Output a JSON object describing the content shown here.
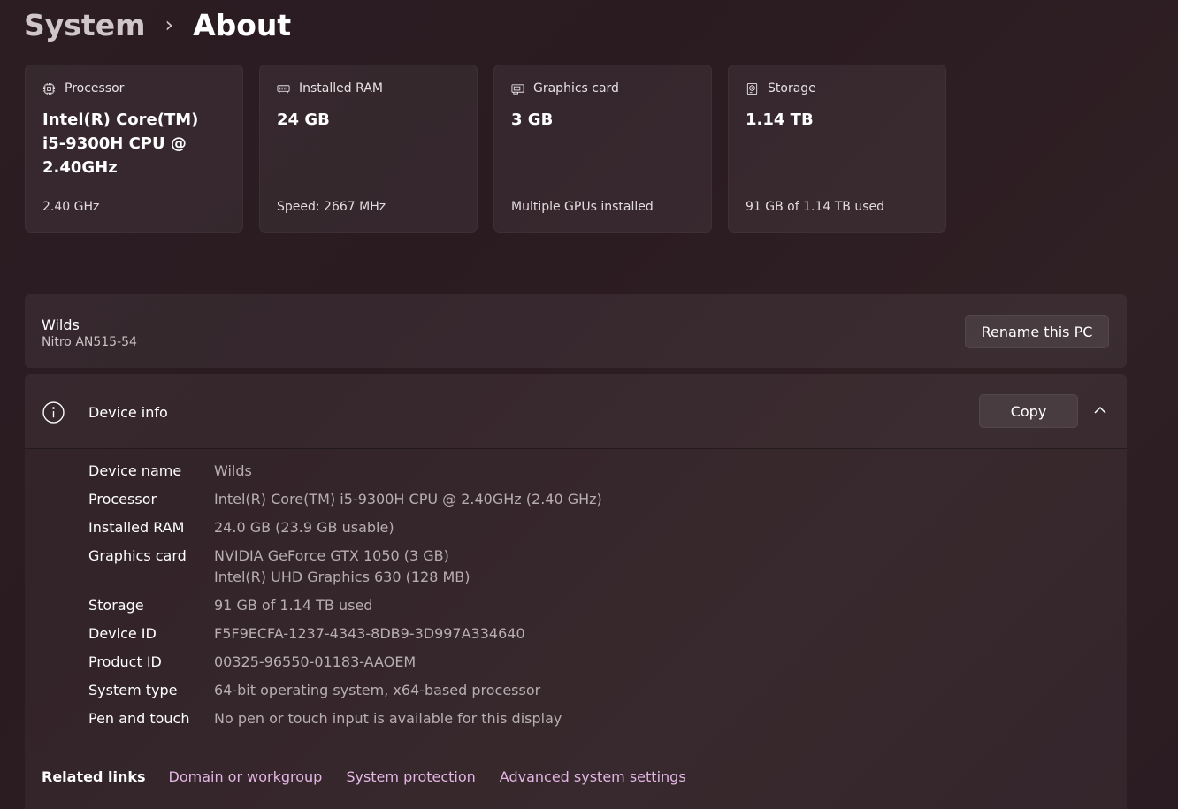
{
  "breadcrumb": {
    "parent": "System",
    "separator": "›",
    "current": "About"
  },
  "cards": [
    {
      "icon": "processor-icon",
      "title": "Processor",
      "value": "Intel(R) Core(TM) i5-9300H CPU @ 2.40GHz",
      "sub": "2.40 GHz"
    },
    {
      "icon": "ram-icon",
      "title": "Installed RAM",
      "value": "24 GB",
      "sub": "Speed: 2667 MHz"
    },
    {
      "icon": "graphics-card-icon",
      "title": "Graphics card",
      "value": "3 GB",
      "sub": "Multiple GPUs installed"
    },
    {
      "icon": "storage-icon",
      "title": "Storage",
      "value": "1.14 TB",
      "sub": "91 GB of 1.14 TB used"
    }
  ],
  "pc": {
    "name": "Wilds",
    "model": "Nitro AN515-54",
    "rename_label": "Rename this PC"
  },
  "device_info": {
    "title": "Device info",
    "copy_label": "Copy",
    "rows": {
      "device_name": {
        "label": "Device name",
        "value": "Wilds"
      },
      "processor": {
        "label": "Processor",
        "value": "Intel(R) Core(TM) i5-9300H CPU @ 2.40GHz (2.40 GHz)"
      },
      "installed_ram": {
        "label": "Installed RAM",
        "value": "24.0 GB (23.9 GB usable)"
      },
      "graphics_card": {
        "label": "Graphics card",
        "value1": "NVIDIA GeForce GTX 1050 (3 GB)",
        "value2": "Intel(R) UHD Graphics 630 (128 MB)"
      },
      "storage": {
        "label": "Storage",
        "value": "91 GB of 1.14 TB used"
      },
      "device_id": {
        "label": "Device ID",
        "value": "F5F9ECFA-1237-4343-8DB9-3D997A334640"
      },
      "product_id": {
        "label": "Product ID",
        "value": "00325-96550-01183-AAOEM"
      },
      "system_type": {
        "label": "System type",
        "value": "64-bit operating system, x64-based processor"
      },
      "pen_touch": {
        "label": "Pen and touch",
        "value": "No pen or touch input is available for this display"
      }
    }
  },
  "related": {
    "title": "Related links",
    "links": [
      "Domain or workgroup",
      "System protection",
      "Advanced system settings"
    ]
  },
  "colors": {
    "link": "#e3b6e4",
    "background": "#2b1d22"
  }
}
